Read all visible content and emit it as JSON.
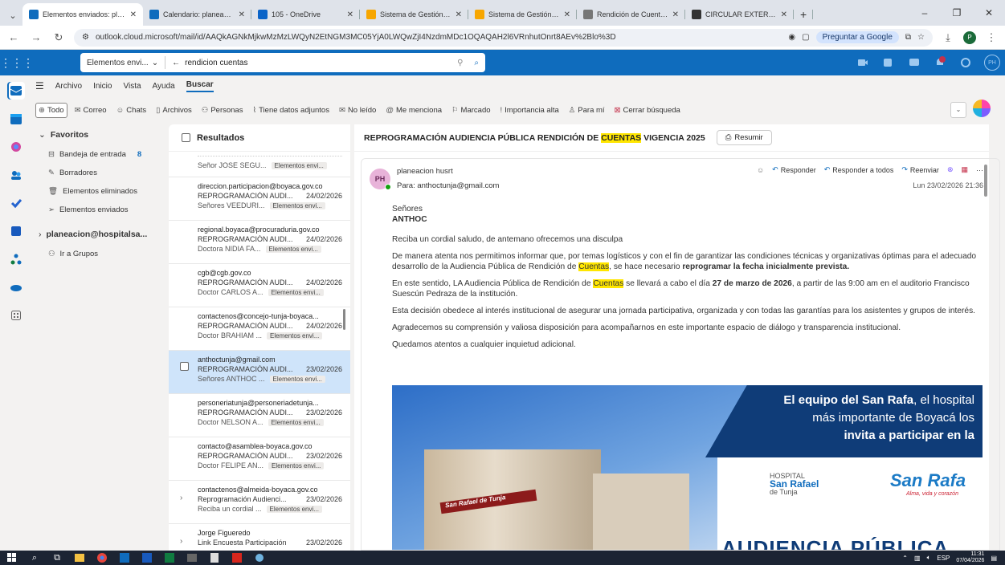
{
  "browser": {
    "tabs": [
      {
        "title": "Elementos enviados: planeacio",
        "active": true,
        "color": "#0f6cbd"
      },
      {
        "title": "Calendario: planeacion hurst - ",
        "active": false,
        "color": "#0f6cbd"
      },
      {
        "title": "105 - OneDrive",
        "active": false,
        "color": "#0a64c8"
      },
      {
        "title": "Sistema de Gestión Integral - A",
        "active": false,
        "color": "#f7a600"
      },
      {
        "title": "Sistema de Gestión Integral - A",
        "active": false,
        "color": "#f7a600"
      },
      {
        "title": "Rendición de Cuentas 2025 – H",
        "active": false,
        "color": "#777777"
      },
      {
        "title": "CIRCULAR EXTERNA 008 DE 20",
        "active": false,
        "color": "#333333"
      }
    ],
    "new_tab": "+",
    "window_controls": {
      "minimize": "–",
      "maximize": "❐",
      "close": "✕"
    },
    "url": "outlook.cloud.microsoft/mail/id/AAQkAGNkMjkwMzMzLWQyN2EtNGM3MC05YjA0LWQwZjI4NzdmMDc1OQAQAH2l6VRnhutOnrt8AEv%2Blo%3D",
    "google_button": "Preguntar a Google",
    "profile_initial": "P"
  },
  "owa": {
    "search_scope": "Elementos envi...",
    "search_query": "rendicion cuentas",
    "user_initials": "PH",
    "ribbon_tabs": [
      "Archivo",
      "Inicio",
      "Vista",
      "Ayuda",
      "Buscar"
    ],
    "filters": [
      {
        "label": "Todo",
        "icon": "globe-icon"
      },
      {
        "label": "Correo",
        "icon": "mail-icon"
      },
      {
        "label": "Chats",
        "icon": "chat-icon"
      },
      {
        "label": "Archivos",
        "icon": "file-icon"
      },
      {
        "label": "Personas",
        "icon": "people-icon"
      },
      {
        "label": "Tiene datos adjuntos",
        "icon": "attachment-icon"
      },
      {
        "label": "No leído",
        "icon": "unread-icon"
      },
      {
        "label": "Me menciona",
        "icon": "mention-icon"
      },
      {
        "label": "Marcado",
        "icon": "flag-icon"
      },
      {
        "label": "Importancia alta",
        "icon": "important-icon"
      },
      {
        "label": "Para mí",
        "icon": "person-icon"
      },
      {
        "label": "Cerrar búsqueda",
        "icon": "close-search-icon"
      }
    ]
  },
  "folders": {
    "favorites_label": "Favoritos",
    "items": [
      {
        "label": "Bandeja de entrada",
        "count": "8",
        "icon": "inbox-icon"
      },
      {
        "label": "Borradores",
        "count": "",
        "icon": "draft-icon"
      },
      {
        "label": "Elementos eliminados",
        "count": "",
        "icon": "trash-icon"
      },
      {
        "label": "Elementos enviados",
        "count": "",
        "icon": "sent-icon"
      }
    ],
    "account": "planeacion@hospitalsa...",
    "groups": "Ir a Grupos"
  },
  "list": {
    "header": "Resultados",
    "messages": [
      {
        "from": "",
        "subject": "",
        "date": "",
        "preview": "Señor JOSE SEGU...",
        "tag": "Elementos envi...",
        "partial": true
      },
      {
        "from": "direccion.participacion@boyaca.gov.co",
        "subject": "REPROGRAMACIÓN AUDI...",
        "date": "24/02/2026",
        "preview": "Señores VEEDURI...",
        "tag": "Elementos envi..."
      },
      {
        "from": "regional.boyaca@procuraduria.gov.co",
        "subject": "REPROGRAMACIÓN AUDI...",
        "date": "24/02/2026",
        "preview": "Doctora NIDIA FA...",
        "tag": "Elementos envi..."
      },
      {
        "from": "cgb@cgb.gov.co",
        "subject": "REPROGRAMACIÓN AUDI...",
        "date": "24/02/2026",
        "preview": "Doctor CARLOS A...",
        "tag": "Elementos envi..."
      },
      {
        "from": "contactenos@concejo-tunja-boyaca...",
        "subject": "REPROGRAMACIÓN AUDI...",
        "date": "24/02/2026",
        "preview": "Doctor BRAHIAM ...",
        "tag": "Elementos envi..."
      },
      {
        "from": "anthoctunja@gmail.com",
        "subject": "REPROGRAMACIÓN AUDI...",
        "date": "23/02/2026",
        "preview": "Señores ANTHOC ...",
        "tag": "Elementos envi...",
        "selected": true
      },
      {
        "from": "personeriatunja@personeriadetunja...",
        "subject": "REPROGRAMACIÓN AUDI...",
        "date": "23/02/2026",
        "preview": "Doctor NELSON A...",
        "tag": "Elementos envi..."
      },
      {
        "from": "contacto@asamblea-boyaca.gov.co",
        "subject": "REPROGRAMACIÓN AUDI...",
        "date": "23/02/2026",
        "preview": "Doctor FELIPE AN...",
        "tag": "Elementos envi..."
      },
      {
        "from": "contactenos@almeida-boyaca.gov.co",
        "subject": "Reprogramación Audienci...",
        "date": "23/02/2026",
        "preview": "Reciba un cordial ...",
        "tag": "Elementos envi...",
        "thread": true
      },
      {
        "from": "Jorge Figueredo",
        "subject": "Link Encuesta Participación",
        "date": "23/02/2026",
        "preview": "",
        "tag": "",
        "thread": true
      }
    ]
  },
  "reading": {
    "subject_pre": "REPROGRAMACIÓN AUDIENCIA PÚBLICA RENDICIÓN DE ",
    "subject_hl": "CUENTAS",
    "subject_post": " VIGENCIA 2025",
    "summarize": "Resumir",
    "sender": "planeacion husrt",
    "avatar": "PH",
    "to": "Para: anthoctunja@gmail.com",
    "date": "Lun 23/02/2026 21:36",
    "actions": {
      "reply": "Responder",
      "reply_all": "Responder a todos",
      "forward": "Reenviar",
      "more": "···"
    },
    "greeting": "Señores",
    "recipient": "ANTHOC",
    "p1": "Reciba un cordial saludo, de antemano ofrecemos una disculpa",
    "p2_a": "De manera atenta nos permitimos informar que, por temas logísticos y con el fin de garantizar las condiciones técnicas y organizativas óptimas para el adecuado desarrollo de la Audiencia Pública de Rendición de ",
    "p2_hl": "Cuentas",
    "p2_b": ", se hace necesario ",
    "p2_bold": "reprogramar la fecha inicialmente prevista",
    "p2_end": ".",
    "p3_a": "En este sentido, LA Audiencia Pública de Rendición de ",
    "p3_hl": "Cuentas",
    "p3_b": " se llevará a cabo el día ",
    "p3_bold": "27 de marzo de 2026",
    "p3_c": ", a partir de las 9:00 am en el auditorio Francisco Suescún Pedraza de la institución.",
    "p4": "Esta decisión obedece al interés institucional de asegurar una jornada participativa, organizada y con todas las garantías para los asistentes y grupos de interés.",
    "p5": "Agradecemos su comprensión y valiosa disposición para acompañarnos en este importante espacio de diálogo y transparencia institucional.",
    "p6": "Quedamos atentos a cualquier inquietud adicional.",
    "banner": {
      "line1_bold": "El equipo del San Rafa",
      "line1_rest": ", el hospital",
      "line2": "más importante de Boyacá los",
      "line3": "invita a participar en la",
      "sign": "San Rafael de Tunja",
      "logo1_top": "HOSPITAL",
      "logo1_mid": "San Rafael",
      "logo1_bot": "de Tunja",
      "logo2": "San Rafa",
      "logo2_tag": "Alma, vida y corazón",
      "bottom": "AUDIENCIA PÚBLICA"
    }
  },
  "taskbar": {
    "lang": "ESP",
    "time": "11:31",
    "date": "07/04/2026"
  }
}
